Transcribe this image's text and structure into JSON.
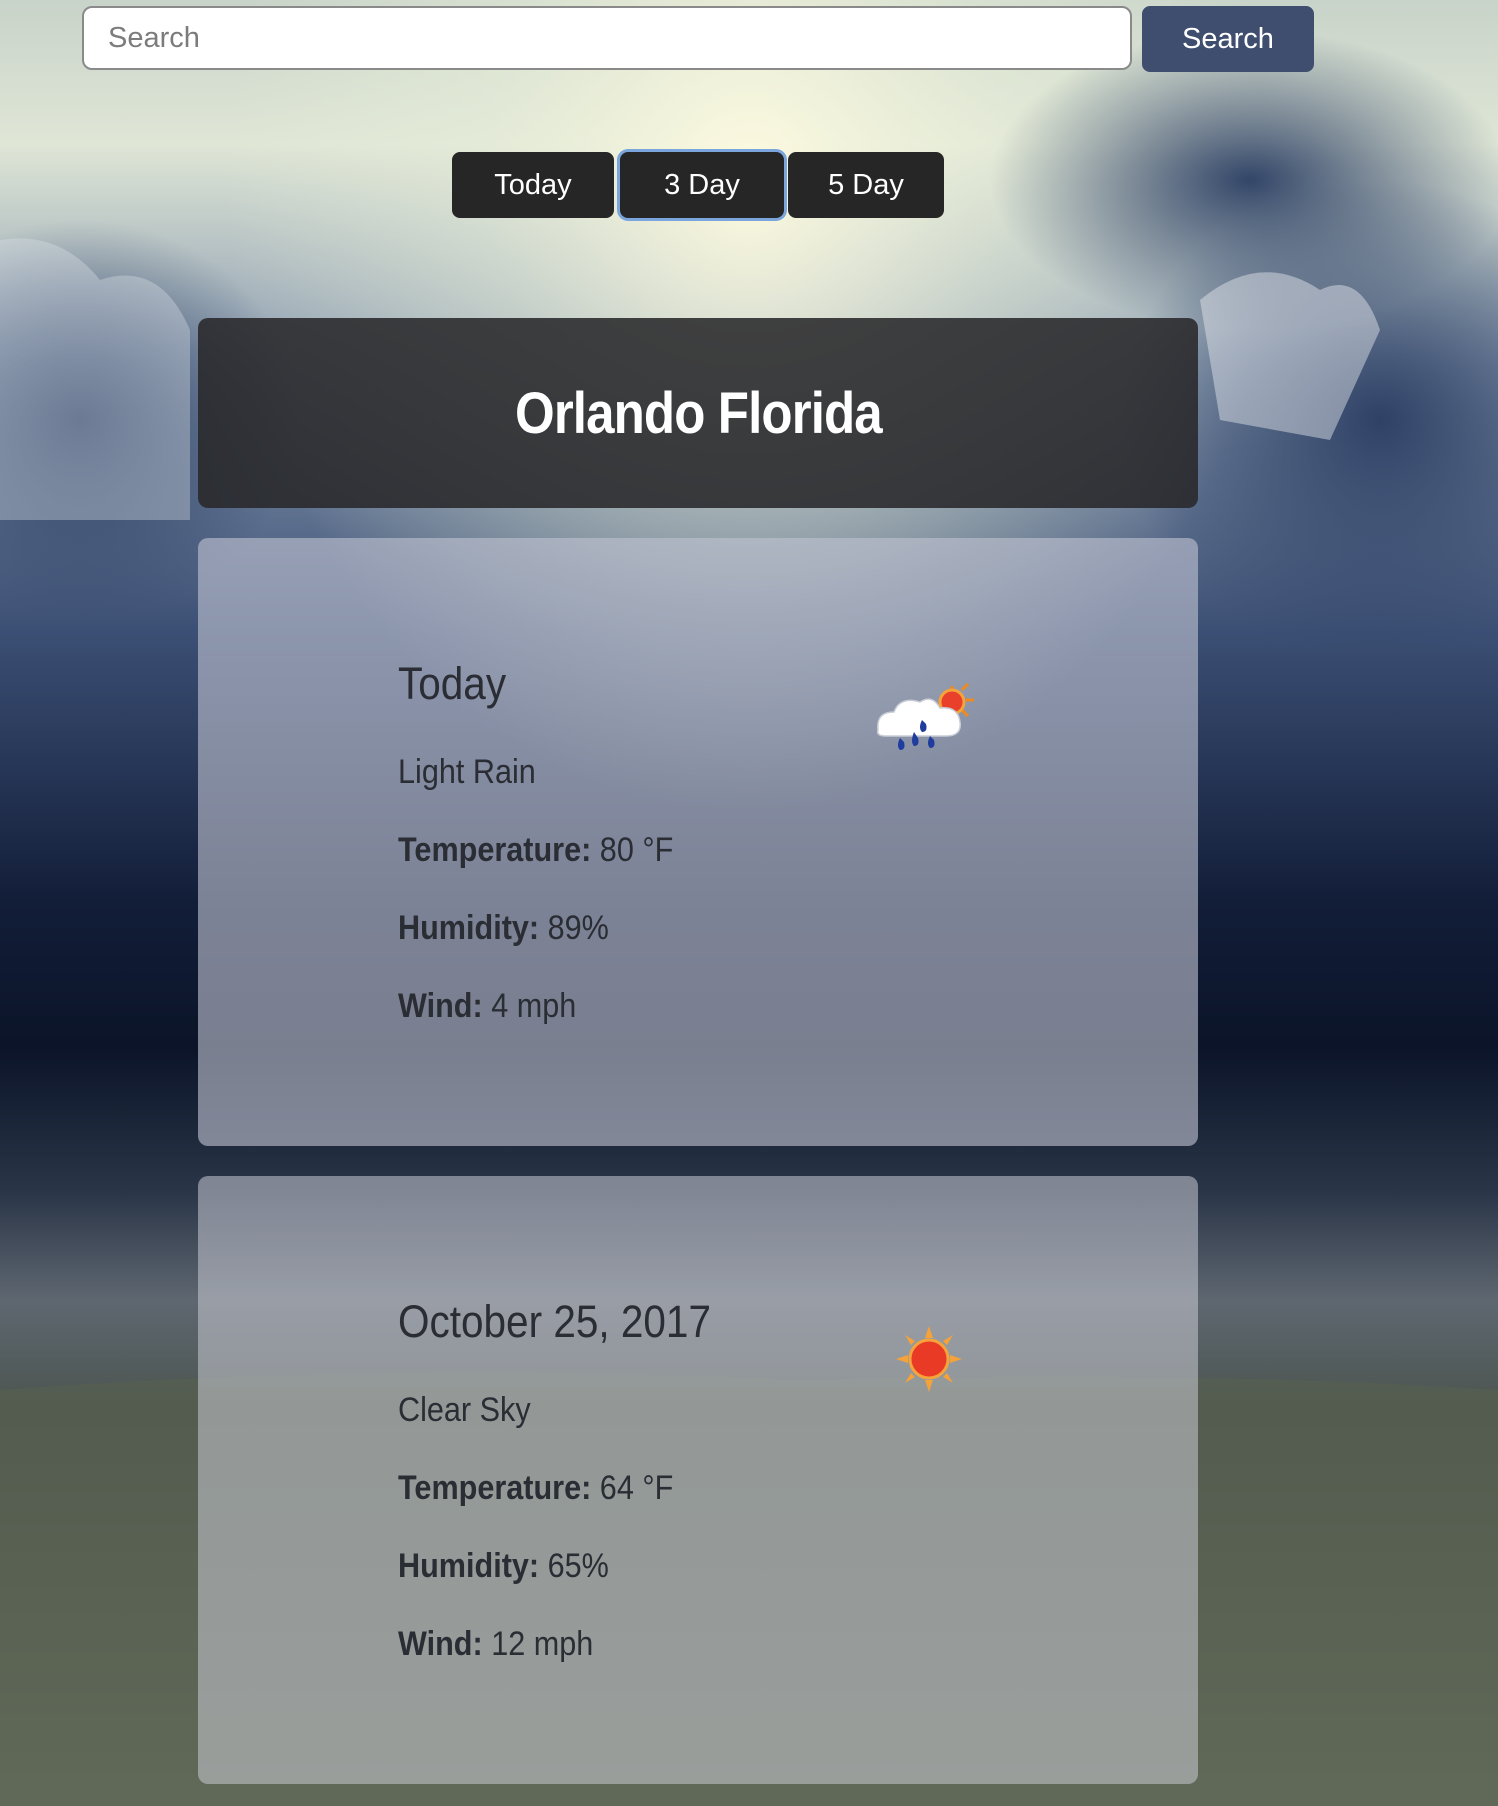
{
  "search": {
    "placeholder": "Search",
    "value": "",
    "button_label": "Search"
  },
  "tabs": [
    {
      "label": "Today",
      "active": false
    },
    {
      "label": "3 Day",
      "active": true
    },
    {
      "label": "5 Day",
      "active": false
    }
  ],
  "location": {
    "title": "Orlando Florida"
  },
  "forecast": [
    {
      "day": "Today",
      "condition": "Light Rain",
      "icon": "rain-cloud-sun-icon",
      "temperature_label": "Temperature:",
      "temperature": "80 °F",
      "humidity_label": "Humidity:",
      "humidity": "89%",
      "wind_label": "Wind:",
      "wind": "4 mph"
    },
    {
      "day": "October 25, 2017",
      "condition": "Clear Sky",
      "icon": "sun-icon",
      "temperature_label": "Temperature:",
      "temperature": "64 °F",
      "humidity_label": "Humidity:",
      "humidity": "65%",
      "wind_label": "Wind:",
      "wind": "12 mph"
    }
  ],
  "colors": {
    "search_button": "#3f4e6e",
    "tab_background": "#262626",
    "tab_active_ring": "#7aa6dd",
    "city_card": "#28282a"
  }
}
